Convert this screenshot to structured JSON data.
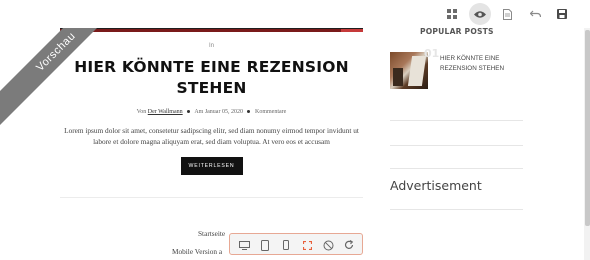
{
  "preview_ribbon": {
    "label": "Vorschau"
  },
  "article": {
    "category": "In",
    "title": "HIER KÖNNTE EINE REZENSION STEHEN",
    "meta": {
      "prefix": "Von",
      "author": "Der Wallmann",
      "date": "Am Januar 05, 2020",
      "comments": "Kommentare"
    },
    "excerpt": "Lorem ipsum dolor sit amet, consetetur sadipscing elitr, sed diam nonumy eirmod tempor invidunt ut labore et dolore magna aliquyam erat, sed diam voluptua. At vero eos et accusam",
    "read_more": "WEITERLESEN"
  },
  "footer": {
    "links": [
      "Startseite",
      "Mobile Version a"
    ]
  },
  "sidebar": {
    "popular_title": "POPULAR POSTS",
    "posts": [
      {
        "number": "01",
        "title": "HIER KÖNNTE EINE REZENSION STEHEN"
      }
    ],
    "advertisement": "Advertisement"
  },
  "toolbar": {
    "icons": [
      "grid-icon",
      "eye-icon",
      "page-icon",
      "undo-icon",
      "save-icon"
    ],
    "active": "eye-icon"
  },
  "device_toolbar": {
    "icons": [
      "desktop-icon",
      "tablet-icon",
      "mobile-icon",
      "fullscreen-icon",
      "rotate-icon",
      "refresh-icon"
    ],
    "accent_color": "#e8603c"
  },
  "colors": {
    "ribbon": "#7b7b7b",
    "button": "#111111",
    "accent": "#e8603c"
  }
}
